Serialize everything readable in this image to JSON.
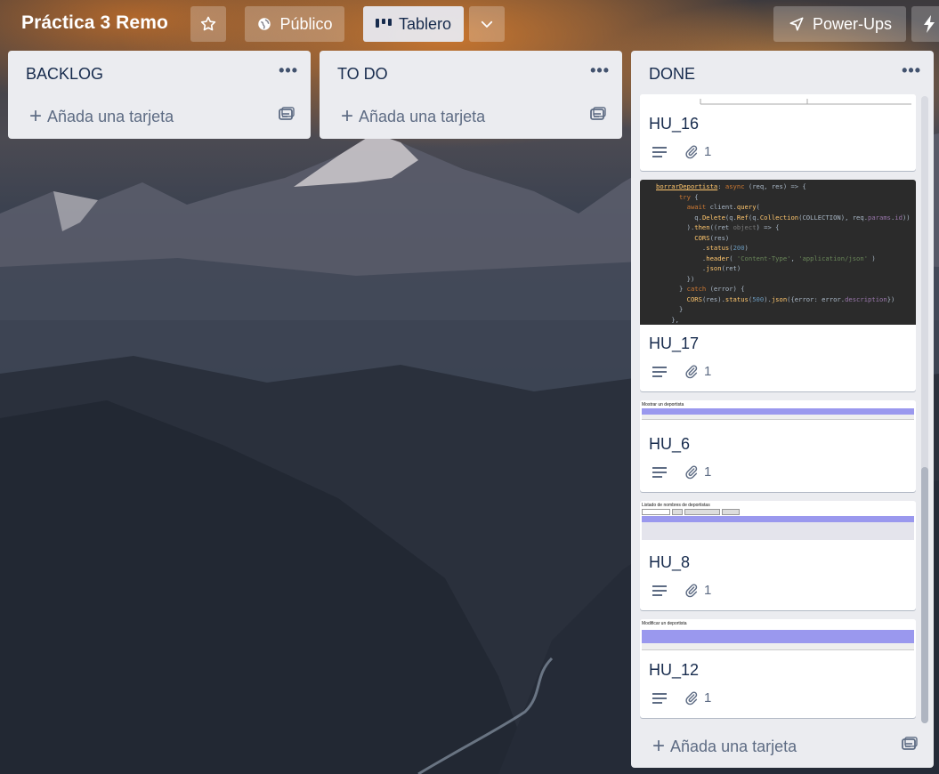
{
  "board": {
    "title": "Práctica 3 Remo",
    "visibility_label": "Público",
    "view_label": "Tablero",
    "powerups_label": "Power-Ups"
  },
  "lists": [
    {
      "title": "BACKLOG",
      "menu": "•••",
      "add_label": "Añada una tarjeta"
    },
    {
      "title": "TO DO",
      "menu": "•••",
      "add_label": "Añada una tarjeta"
    },
    {
      "title": "DONE",
      "menu": "•••",
      "add_label": "Añada una tarjeta",
      "cards": [
        {
          "title": "HU_16",
          "attachments": "1"
        },
        {
          "title": "HU_17",
          "attachments": "1"
        },
        {
          "title": "HU_6",
          "attachments": "1"
        },
        {
          "title": "HU_8",
          "attachments": "1"
        },
        {
          "title": "HU_12",
          "attachments": "1"
        }
      ]
    }
  ],
  "covers": {
    "hu6_caption": "Mostrar un deportista",
    "hu8_caption": "Listado de nombres de deportistas",
    "hu12_caption": "Modificar un deportista"
  },
  "colors": {
    "list_bg": "#ebecf0",
    "text_primary": "#172b4d",
    "text_muted": "#5e6c84",
    "table_header": "#9a98ee"
  }
}
